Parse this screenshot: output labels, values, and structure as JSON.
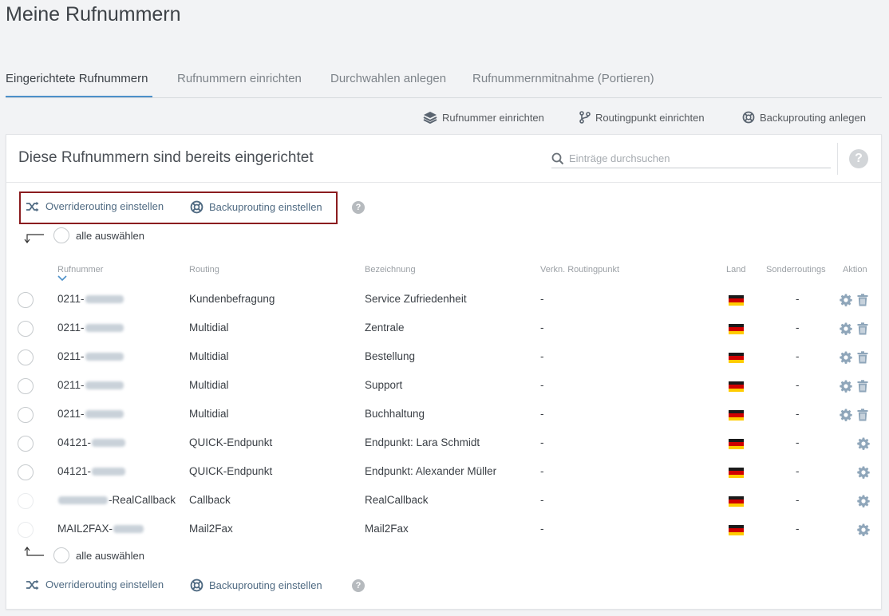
{
  "page": {
    "title": "Meine Rufnummern"
  },
  "tabs": [
    {
      "label": "Eingerichtete Rufnummern",
      "active": true
    },
    {
      "label": "Rufnummern einrichten",
      "active": false
    },
    {
      "label": "Durchwahlen anlegen",
      "active": false
    },
    {
      "label": "Rufnummernmitnahme (Portieren)",
      "active": false
    }
  ],
  "toolbar": {
    "rufnummer_label": "Rufnummer einrichten",
    "routingpunkt_label": "Routingpunkt einrichten",
    "backup_label": "Backuprouting anlegen"
  },
  "panel": {
    "title": "Diese Rufnummern sind bereits eingerichtet",
    "search_placeholder": "Einträge durchsuchen",
    "help_glyph": "?"
  },
  "bulk_actions": {
    "override_label": "Overriderouting einstellen",
    "backup_label": "Backuprouting einstellen",
    "help_glyph": "?",
    "select_all_label": "alle auswählen"
  },
  "table": {
    "headers": {
      "number": "Rufnummer",
      "routing": "Routing",
      "name": "Bezeichnung",
      "linked": "Verkn. Routingpunkt",
      "country": "Land",
      "special": "Sonderroutings",
      "action": "Aktion"
    },
    "rows": [
      {
        "prefix": "0211-",
        "suffix": "",
        "routing": "Kundenbefragung",
        "name": "Service Zufriedenheit",
        "linked": "-",
        "special": "-",
        "deletable": true
      },
      {
        "prefix": "0211-",
        "suffix": "",
        "routing": "Multidial",
        "name": "Zentrale",
        "linked": "-",
        "special": "-",
        "deletable": true
      },
      {
        "prefix": "0211-",
        "suffix": "",
        "routing": "Multidial",
        "name": "Bestellung",
        "linked": "-",
        "special": "-",
        "deletable": true
      },
      {
        "prefix": "0211-",
        "suffix": "",
        "routing": "Multidial",
        "name": "Support",
        "linked": "-",
        "special": "-",
        "deletable": true
      },
      {
        "prefix": "0211-",
        "suffix": "",
        "routing": "Multidial",
        "name": "Buchhaltung",
        "linked": "-",
        "special": "-",
        "deletable": true
      },
      {
        "prefix": "04121-",
        "suffix": "",
        "routing": "QUICK-Endpunkt",
        "name": "Endpunkt: Lara Schmidt",
        "linked": "-",
        "special": "-",
        "deletable": false
      },
      {
        "prefix": "04121-",
        "suffix": "",
        "routing": "QUICK-Endpunkt",
        "name": "Endpunkt: Alexander Müller",
        "linked": "-",
        "special": "-",
        "deletable": false
      },
      {
        "prefix": "",
        "suffix": "-RealCallback",
        "routing": "Callback",
        "name": "RealCallback",
        "linked": "-",
        "special": "-",
        "deletable": false
      },
      {
        "prefix": "MAIL2FAX-",
        "suffix": "",
        "routing": "Mail2Fax",
        "name": "Mail2Fax",
        "linked": "-",
        "special": "-",
        "deletable": false
      }
    ]
  },
  "colors": {
    "accent": "#4c90c9",
    "highlight_border": "#8b1c1f",
    "icon": "#8fa6ba"
  }
}
